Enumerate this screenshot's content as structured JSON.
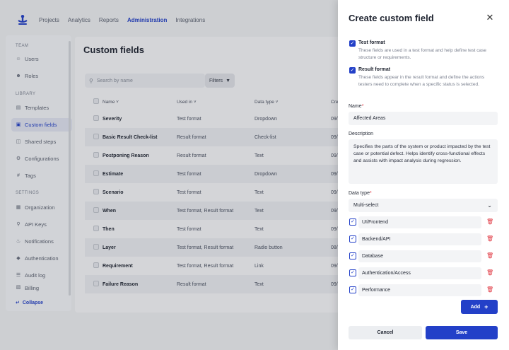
{
  "nav": {
    "links": [
      "Projects",
      "Analytics",
      "Reports",
      "Administration",
      "Integrations"
    ],
    "active": "Administration"
  },
  "sidebar": {
    "sections": {
      "team": "TEAM",
      "library": "LIBRARY",
      "settings": "SETTINGS"
    },
    "items": [
      {
        "label": "Users",
        "icon": "users-icon"
      },
      {
        "label": "Roles",
        "icon": "roles-icon"
      },
      {
        "label": "Templates",
        "icon": "templates-icon"
      },
      {
        "label": "Custom fields",
        "icon": "custom-fields-icon",
        "active": true
      },
      {
        "label": "Shared steps",
        "icon": "shared-steps-icon"
      },
      {
        "label": "Configurations",
        "icon": "configurations-icon"
      },
      {
        "label": "Tags",
        "icon": "hash-icon"
      },
      {
        "label": "Organization",
        "icon": "organization-icon"
      },
      {
        "label": "API Keys",
        "icon": "key-icon"
      },
      {
        "label": "Notifications",
        "icon": "bell-icon"
      },
      {
        "label": "Authentication",
        "icon": "shield-icon"
      },
      {
        "label": "Audit log",
        "icon": "audit-icon"
      },
      {
        "label": "Billing",
        "icon": "billing-icon"
      }
    ],
    "collapse": "Collapse"
  },
  "main": {
    "title": "Custom fields",
    "search_placeholder": "Search by name",
    "filters_label": "Filters",
    "columns": {
      "name": "Name",
      "used_in": "Used in",
      "data_type": "Data type",
      "created": "Cre"
    },
    "rows": [
      {
        "name": "Severity",
        "used_in": "Test format",
        "type": "Dropdown",
        "created": "09/"
      },
      {
        "name": "Basic Result Check-list",
        "used_in": "Result format",
        "type": "Check-list",
        "created": "09/"
      },
      {
        "name": "Postponing Reason",
        "used_in": "Result format",
        "type": "Text",
        "created": "09/"
      },
      {
        "name": "Estimate",
        "used_in": "Test format",
        "type": "Dropdown",
        "created": "09/"
      },
      {
        "name": "Scenario",
        "used_in": "Test format",
        "type": "Text",
        "created": "09/"
      },
      {
        "name": "When",
        "used_in": "Test format, Result format",
        "type": "Text",
        "created": "09/"
      },
      {
        "name": "Then",
        "used_in": "Test format",
        "type": "Text",
        "created": "09/"
      },
      {
        "name": "Layer",
        "used_in": "Test format, Result format",
        "type": "Radio button",
        "created": "08/"
      },
      {
        "name": "Requirement",
        "used_in": "Test format, Result format",
        "type": "Link",
        "created": "09/"
      },
      {
        "name": "Failure Reason",
        "used_in": "Result format",
        "type": "Text",
        "created": "09/"
      }
    ]
  },
  "drawer": {
    "title": "Create custom field",
    "test_format": {
      "label": "Test format",
      "description": "These fields are used in a test format and help define test case structure or requirements.",
      "checked": true
    },
    "result_format": {
      "label": "Result format",
      "description": "These fields appear in the result format and define the actions testers need to complete when a specific status is selected.",
      "checked": true
    },
    "name_label": "Name",
    "name_value": "Affected Areas",
    "description_label": "Description",
    "description_value": "Specifies the parts of the system or product impacted by the test case or potential defect. Helps identify cross-functional effects and assists with impact analysis during regression.",
    "data_type_label": "Data type",
    "data_type_value": "Multi-select",
    "options": [
      "UI/Frontend",
      "Backend/API",
      "Database",
      "Authentication/Access",
      "Performance"
    ],
    "add_label": "Add",
    "cancel_label": "Cancel",
    "save_label": "Save",
    "required_mark": "*"
  },
  "colors": {
    "accent": "#2340c8",
    "danger": "#e0353f"
  }
}
